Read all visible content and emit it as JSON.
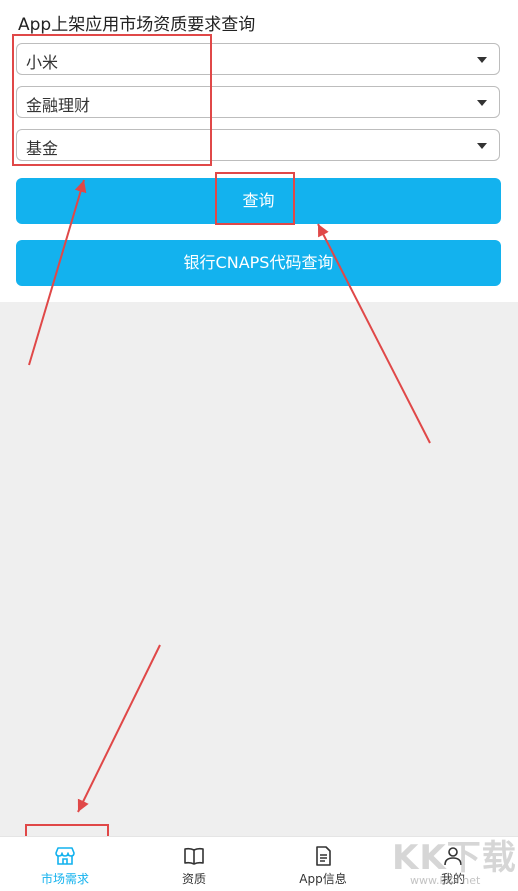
{
  "page": {
    "title": "App上架应用市场资质要求查询"
  },
  "form": {
    "market_select": {
      "value": "小米"
    },
    "category_select": {
      "value": "金融理财"
    },
    "subcategory_select": {
      "value": "基金"
    },
    "query_button": "查询",
    "cnaps_button": "银行CNAPS代码查询"
  },
  "tabbar": {
    "items": [
      {
        "label": "市场需求",
        "icon": "store-icon",
        "active": true
      },
      {
        "label": "资质",
        "icon": "book-icon",
        "active": false
      },
      {
        "label": "App信息",
        "icon": "document-icon",
        "active": false
      },
      {
        "label": "我的",
        "icon": "user-icon",
        "active": false
      }
    ]
  },
  "watermark": {
    "text": "KK下载",
    "sub": "www.kkx.net"
  },
  "colors": {
    "accent": "#13b2ee",
    "annotation": "#e04848"
  }
}
